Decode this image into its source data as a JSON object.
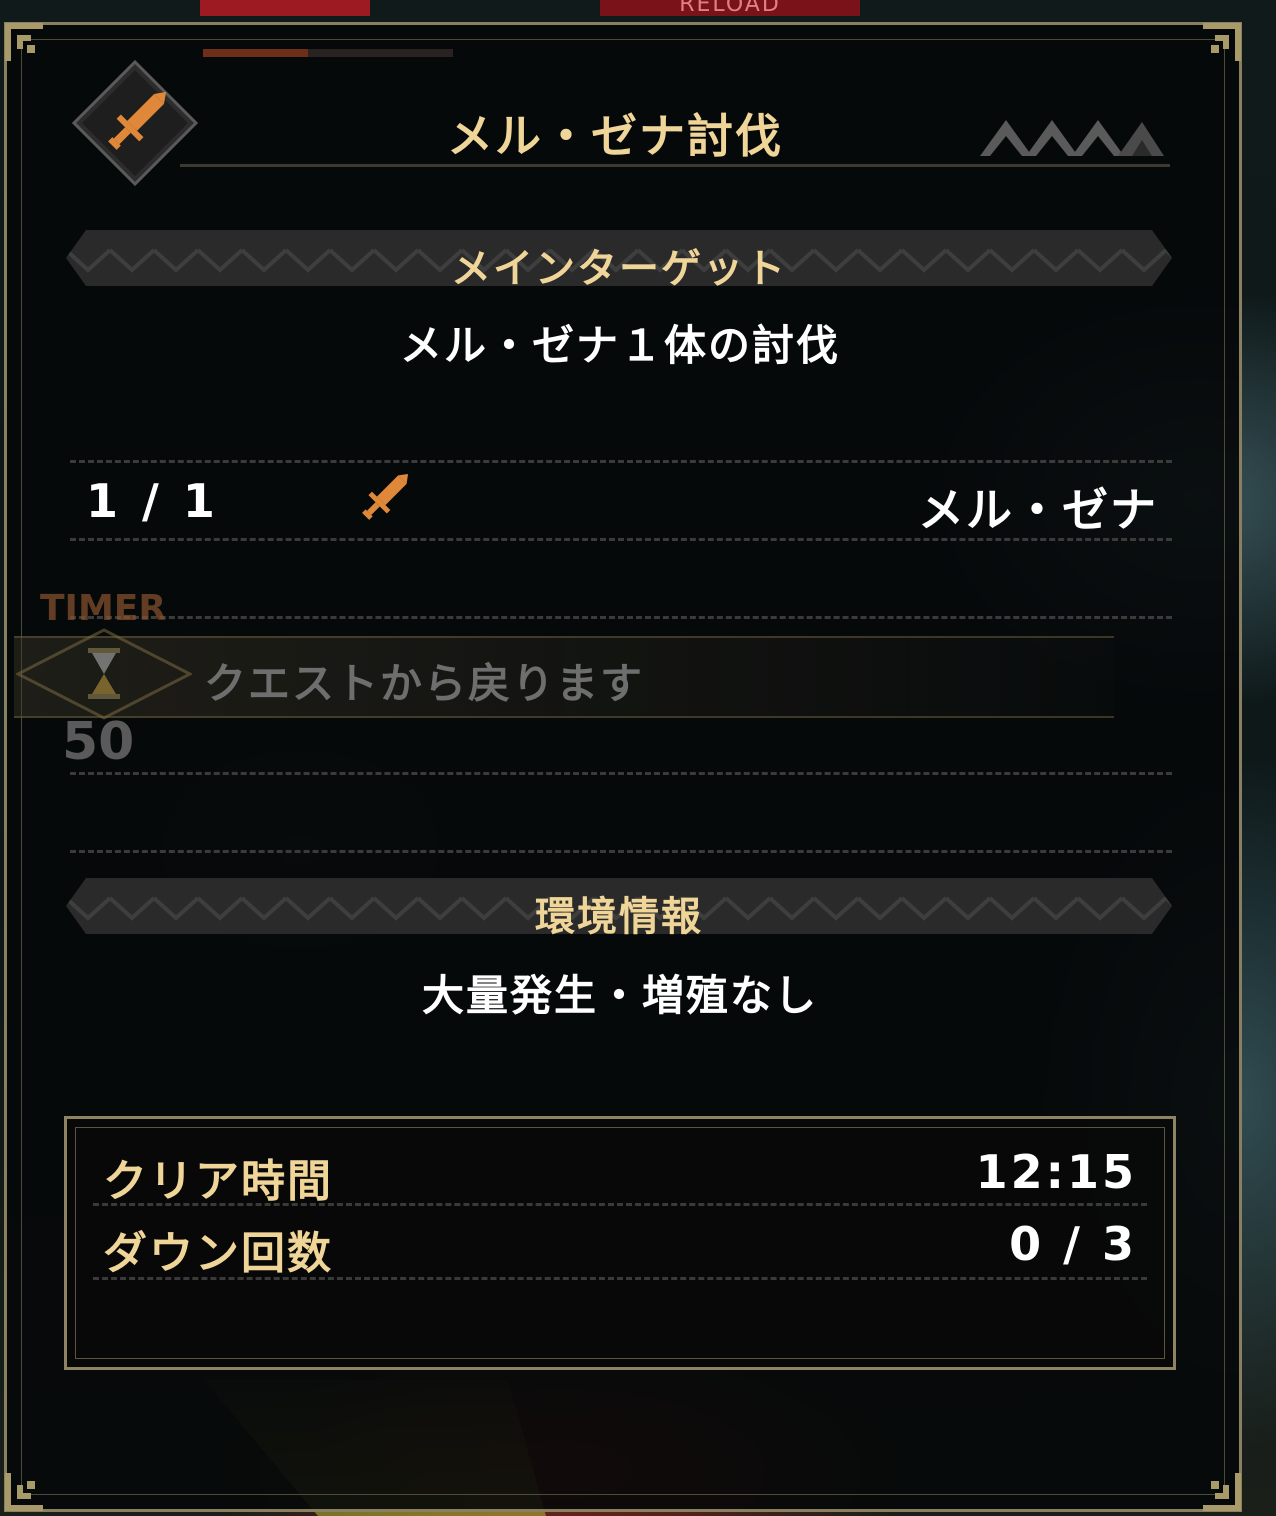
{
  "hud": {
    "reload_label": "RELOAD",
    "quest_progress": 0.42
  },
  "quest": {
    "title": "メル・ゼナ討伐",
    "rank_icon": "rank-peaks-icon",
    "emblem_icon": "sword-icon"
  },
  "main_target": {
    "heading": "メインターゲット",
    "objective": "メル・ゼナ１体の討伐",
    "count": "1 / 1",
    "target_icon": "sword-icon",
    "monster": "メル・ゼナ"
  },
  "timer": {
    "label": "TIMER",
    "message": "クエストから戻ります",
    "count": "50"
  },
  "environment": {
    "heading": "環境情報",
    "value": "大量発生・増殖なし"
  },
  "stats": {
    "clear_time_label": "クリア時間",
    "clear_time_value": "12:15",
    "downs_label": "ダウン回数",
    "downs_value": "0 / 3"
  },
  "colors": {
    "gold_text": "#f0d598",
    "frame": "#8a8060",
    "icon_orange": "#e0883a"
  }
}
